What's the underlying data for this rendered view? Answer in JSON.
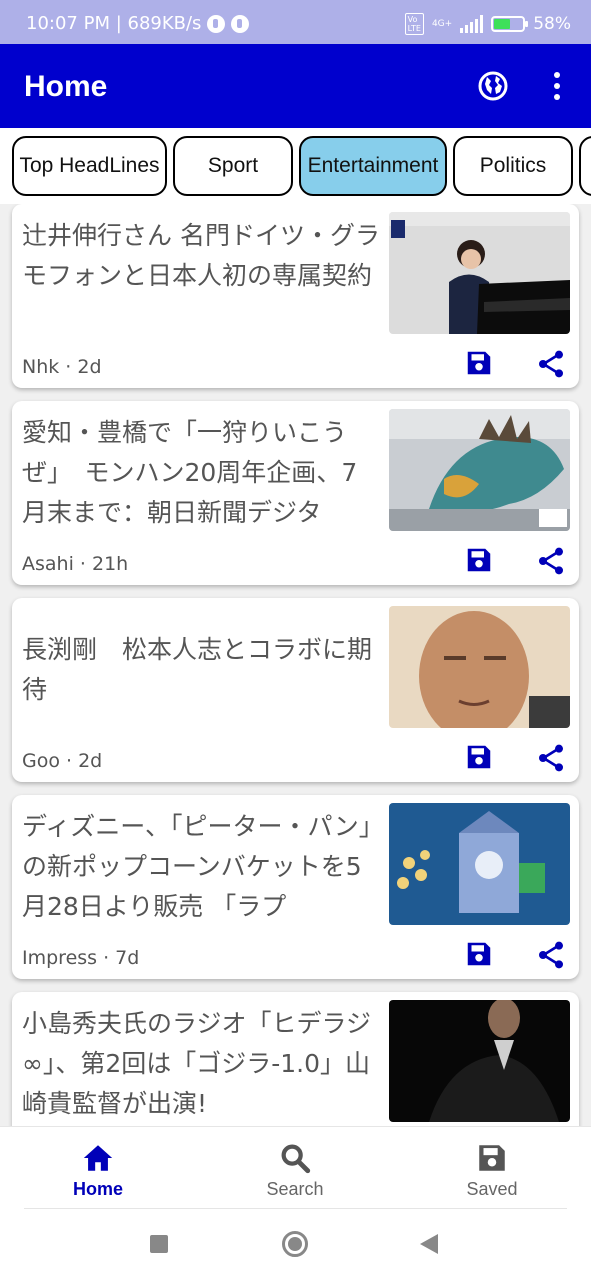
{
  "status_bar": {
    "time_speed": "10:07 PM | 689KB/s",
    "network": "4G+",
    "battery": "58%"
  },
  "app_bar": {
    "title": "Home",
    "icons": [
      "globe-icon",
      "more-vertical-icon"
    ]
  },
  "categories": [
    {
      "label": "Top HeadLines",
      "active": false
    },
    {
      "label": "Sport",
      "active": false
    },
    {
      "label": "Entertainment",
      "active": true
    },
    {
      "label": "Politics",
      "active": false
    }
  ],
  "articles": [
    {
      "title": "辻井伸行さん 名門ドイツ・グラモフォンと日本人初の専属契約",
      "source": "Nhk",
      "age": "2d",
      "meta": "Nhk · 2d",
      "thumb": "pianist-photo"
    },
    {
      "title": "愛知・豊橋で「一狩りいこうぜ」　モンハン20周年企画、7月末まで：朝日新聞デジタ",
      "source": "Asahi",
      "age": "21h",
      "meta": "Asahi · 21h",
      "thumb": "monster-statue-photo"
    },
    {
      "title": "長渕剛　松本人志とコラボに期待",
      "source": "Goo",
      "age": "2d",
      "meta": "Goo · 2d",
      "thumb": "portrait-photo"
    },
    {
      "title": "ディズニー、「ピーター・パン」の新ポップコーンバケットを5月28日より販売 「ラプ",
      "source": "Impress",
      "age": "7d",
      "meta": "Impress · 7d",
      "thumb": "popcorn-bucket-photo"
    },
    {
      "title": "小島秀夫氏のラジオ「ヒデラジ∞」、第2回は「ゴジラ-1.0」山崎貴監督が出演!",
      "source": "",
      "age": "",
      "meta": "",
      "thumb": "dark-portrait-photo"
    }
  ],
  "bottom_nav": [
    {
      "label": "Home",
      "icon": "home-icon",
      "active": true
    },
    {
      "label": "Search",
      "icon": "search-icon",
      "active": false
    },
    {
      "label": "Saved",
      "icon": "save-icon",
      "active": false
    }
  ],
  "colors": {
    "primary": "#0000cd",
    "chip_active": "#87ceeb",
    "action_icon": "#0000b8",
    "status_bar": "#aeb0e8"
  }
}
